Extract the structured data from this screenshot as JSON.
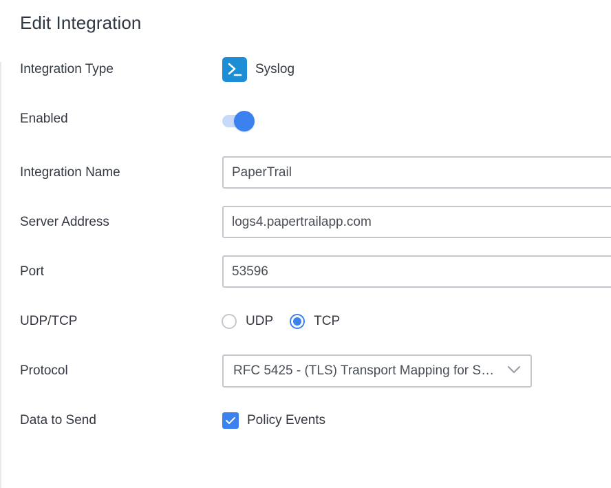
{
  "page": {
    "title": "Edit Integration"
  },
  "form": {
    "integration_type": {
      "label": "Integration Type",
      "value": "Syslog",
      "icon": "terminal-prompt-icon",
      "icon_color": "#1b8ed6"
    },
    "enabled": {
      "label": "Enabled",
      "checked": true,
      "accent": "#3b82f0"
    },
    "integration_name": {
      "label": "Integration Name",
      "value": "PaperTrail"
    },
    "server_address": {
      "label": "Server Address",
      "value": "logs4.papertrailapp.com"
    },
    "port": {
      "label": "Port",
      "value": "53596"
    },
    "transport": {
      "label": "UDP/TCP",
      "options": [
        {
          "label": "UDP",
          "checked": false
        },
        {
          "label": "TCP",
          "checked": true
        }
      ]
    },
    "protocol": {
      "label": "Protocol",
      "selected": "RFC 5425 - (TLS) Transport Mapping for Syslog"
    },
    "data_to_send": {
      "label": "Data to Send",
      "options": [
        {
          "label": "Policy Events",
          "checked": true
        }
      ]
    }
  }
}
